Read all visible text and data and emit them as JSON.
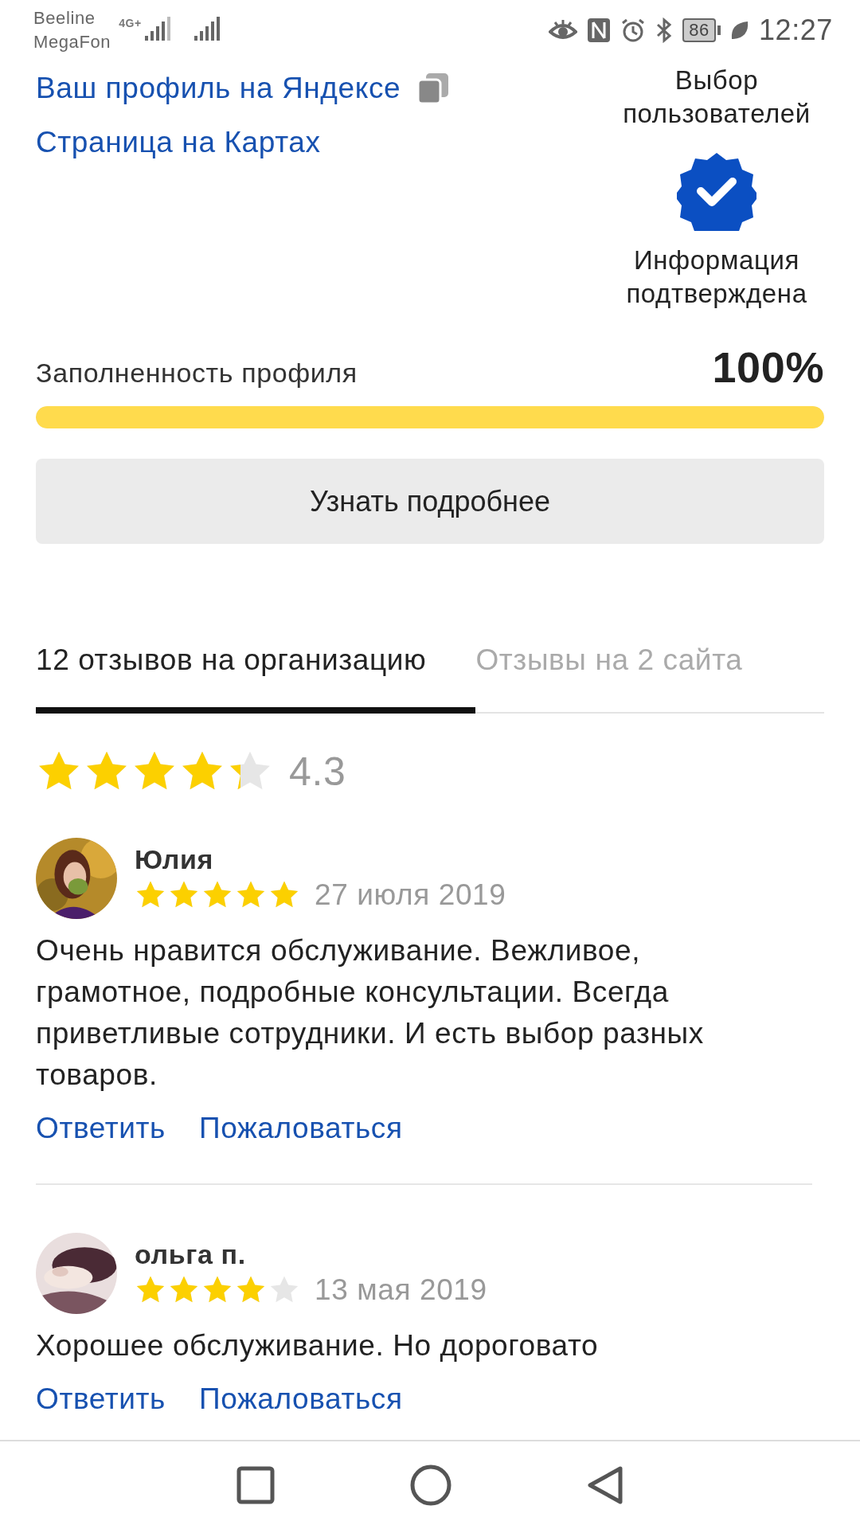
{
  "status_bar": {
    "carriers": [
      "Beeline",
      "MegaFon"
    ],
    "network": "4G+",
    "battery": "86",
    "time": "12:27"
  },
  "profile": {
    "links": [
      {
        "label": "Ваш профиль на Яндексе",
        "kind": "copy"
      },
      {
        "label": "Страница на Картах",
        "kind": "plain"
      }
    ],
    "badge_top": "Выбор пользователей",
    "badge_bottom": "Информация подтверждена",
    "completeness_label": "Заполненность профиля",
    "completeness_value": "100%",
    "level": 1.0,
    "button": "Узнать подробнее"
  },
  "tabs": [
    {
      "label": "12 отзывов на организацию",
      "selected": true
    },
    {
      "label": "Отзывы на 2 сайта",
      "selected": false
    }
  ],
  "rating": {
    "stars": 4.3,
    "value": "4.3"
  },
  "reviews": [
    {
      "author": "Юлия",
      "stars": 5,
      "date": "27 июля 2019",
      "text": "Очень нравится обслуживание. Вежливое, грамотное, подробные консультации. Всегда приветливые сотрудники. И есть выбор разных товаров.",
      "actions": [
        "Ответить",
        "Пожаловаться"
      ]
    },
    {
      "author": "ольга п.",
      "stars": 4,
      "date": "13 мая 2019",
      "text": "Хорошее обслуживание. Но дороговато",
      "actions": [
        "Ответить",
        "Пожаловаться"
      ]
    }
  ]
}
